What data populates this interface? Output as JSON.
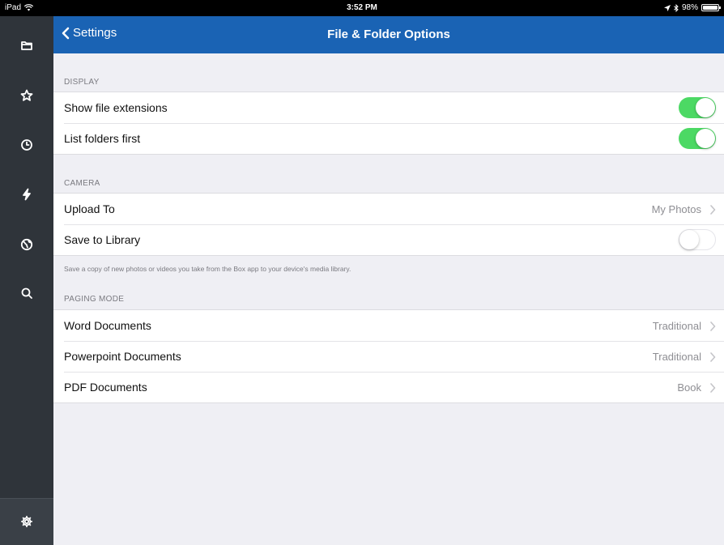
{
  "status_bar": {
    "device": "iPad",
    "time": "3:52 PM",
    "battery": "98%"
  },
  "sidebar": {
    "items": [
      {
        "icon": "folder-icon"
      },
      {
        "icon": "star-icon"
      },
      {
        "icon": "clock-icon"
      },
      {
        "icon": "lightning-icon"
      },
      {
        "icon": "globe-icon"
      },
      {
        "icon": "search-icon"
      }
    ],
    "bottom_icon": "gear-icon"
  },
  "navbar": {
    "back_label": "Settings",
    "title": "File & Folder Options"
  },
  "sections": {
    "display": {
      "header": "DISPLAY",
      "rows": [
        {
          "label": "Show file extensions",
          "toggle": true
        },
        {
          "label": "List folders first",
          "toggle": true
        }
      ]
    },
    "camera": {
      "header": "CAMERA",
      "rows": [
        {
          "label": "Upload To",
          "value": "My Photos"
        },
        {
          "label": "Save to Library",
          "toggle": false
        }
      ],
      "footer": "Save a copy of new photos or videos you take from the Box app to your device's media library."
    },
    "paging": {
      "header": "PAGING MODE",
      "rows": [
        {
          "label": "Word Documents",
          "value": "Traditional"
        },
        {
          "label": "Powerpoint Documents",
          "value": "Traditional"
        },
        {
          "label": "PDF Documents",
          "value": "Book"
        }
      ]
    }
  },
  "colors": {
    "nav_blue": "#1a63b4",
    "sidebar_dark": "#2f343a",
    "toggle_on": "#4cd964",
    "background": "#efeff4"
  }
}
